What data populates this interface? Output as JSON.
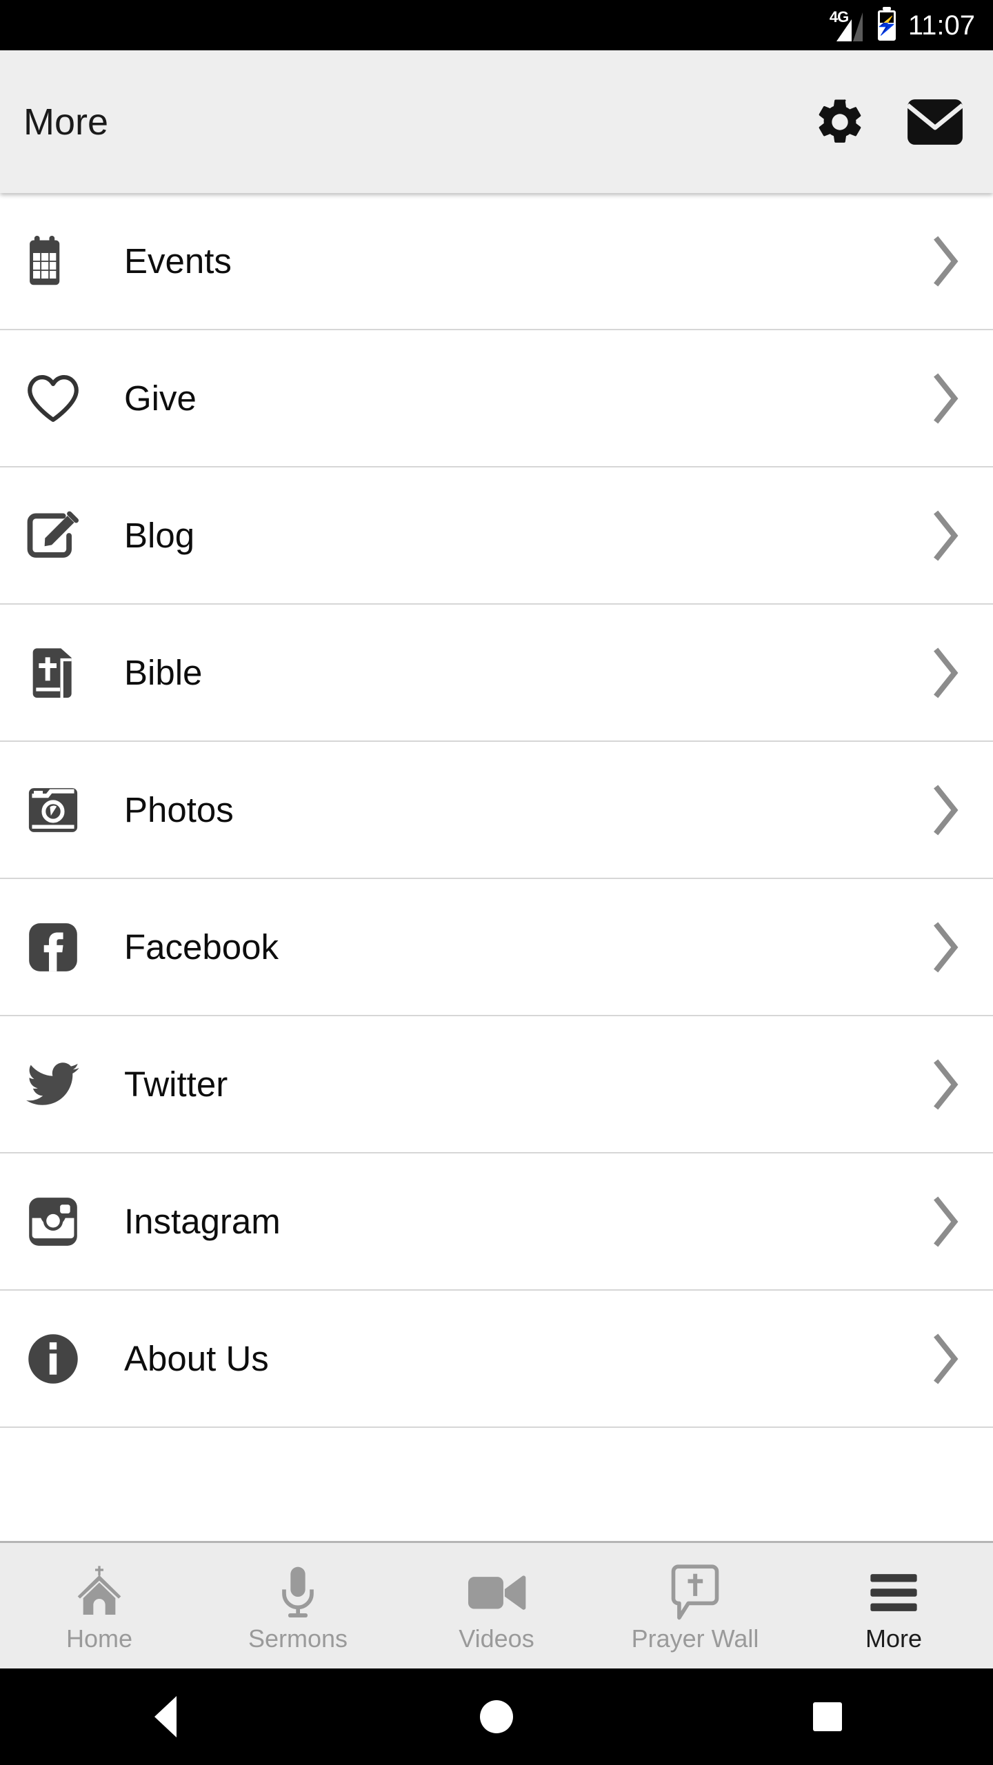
{
  "status_bar": {
    "network": "4G",
    "time": "11:07",
    "battery_state": "charging"
  },
  "app_bar": {
    "title": "More",
    "actions": [
      {
        "name": "settings",
        "icon": "gear-icon"
      },
      {
        "name": "mail",
        "icon": "envelope-icon"
      }
    ]
  },
  "list": {
    "items": [
      {
        "label": "Events",
        "icon": "calendar-icon",
        "chevron": "chevron-right-icon"
      },
      {
        "label": "Give",
        "icon": "heart-icon",
        "chevron": "chevron-right-icon"
      },
      {
        "label": "Blog",
        "icon": "edit-pencil-icon",
        "chevron": "chevron-right-icon"
      },
      {
        "label": "Bible",
        "icon": "bible-book-icon",
        "chevron": "chevron-right-icon"
      },
      {
        "label": "Photos",
        "icon": "camera-icon",
        "chevron": "chevron-right-icon"
      },
      {
        "label": "Facebook",
        "icon": "facebook-icon",
        "chevron": "chevron-right-icon"
      },
      {
        "label": "Twitter",
        "icon": "twitter-bird-icon",
        "chevron": "chevron-right-icon"
      },
      {
        "label": "Instagram",
        "icon": "instagram-icon",
        "chevron": "chevron-right-icon"
      },
      {
        "label": "About Us",
        "icon": "info-circle-icon",
        "chevron": "chevron-right-icon"
      }
    ]
  },
  "tab_bar": {
    "tabs": [
      {
        "label": "Home",
        "icon": "church-icon",
        "active": false
      },
      {
        "label": "Sermons",
        "icon": "microphone-icon",
        "active": false
      },
      {
        "label": "Videos",
        "icon": "video-camera-icon",
        "active": false
      },
      {
        "label": "Prayer Wall",
        "icon": "prayer-bubble-icon",
        "active": false
      },
      {
        "label": "More",
        "icon": "hamburger-menu-icon",
        "active": true
      }
    ]
  },
  "nav_bar": {
    "buttons": [
      {
        "name": "back",
        "icon": "triangle-back-icon"
      },
      {
        "name": "home",
        "icon": "circle-home-icon"
      },
      {
        "name": "recents",
        "icon": "square-recents-icon"
      }
    ]
  },
  "colors": {
    "status_bar_bg": "#000000",
    "app_bar_bg": "#eeeeee",
    "list_bg": "#ffffff",
    "icon_dark": "#444444",
    "divider": "#d6d6d6",
    "tab_bar_bg": "#ececec",
    "tab_inactive": "#9a9a9a",
    "tab_active": "#1d1d1d",
    "chevron": "#8c8c8c"
  }
}
